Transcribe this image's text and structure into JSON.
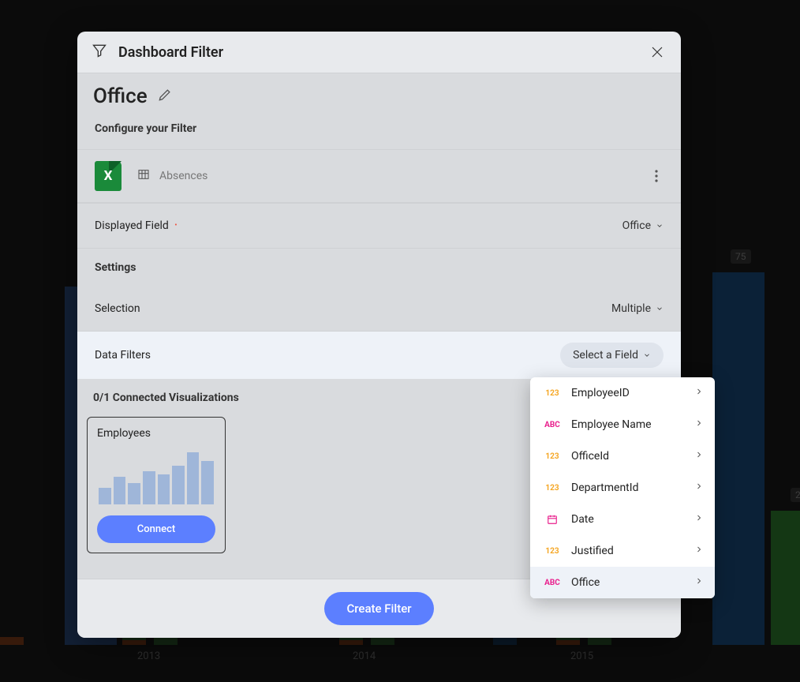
{
  "dialog": {
    "title": "Dashboard Filter",
    "filterName": "Office",
    "configure_label": "Configure your Filter",
    "source": {
      "name": "Absences"
    },
    "displayedField": {
      "label": "Displayed Field",
      "value": "Office"
    },
    "settings_header": "Settings",
    "selection": {
      "label": "Selection",
      "value": "Multiple"
    },
    "dataFilters": {
      "label": "Data Filters",
      "pill": "Select a Field"
    },
    "connected_label": "0/1 Connected Visualizations",
    "viz": {
      "title": "Employees",
      "connect": "Connect"
    },
    "create_button": "Create Filter"
  },
  "popover": {
    "items": [
      {
        "type": "num",
        "label": "EmployeeID"
      },
      {
        "type": "abc",
        "label": "Employee Name"
      },
      {
        "type": "num",
        "label": "OfficeId"
      },
      {
        "type": "num",
        "label": "DepartmentId"
      },
      {
        "type": "cal",
        "label": "Date"
      },
      {
        "type": "num",
        "label": "Justified"
      },
      {
        "type": "abc",
        "label": "Office",
        "active": true
      }
    ]
  },
  "type_labels": {
    "num": "123",
    "abc": "ABC"
  },
  "background": {
    "years": [
      "2013",
      "2014",
      "2015"
    ],
    "badge75": "75",
    "badge2": "2"
  }
}
